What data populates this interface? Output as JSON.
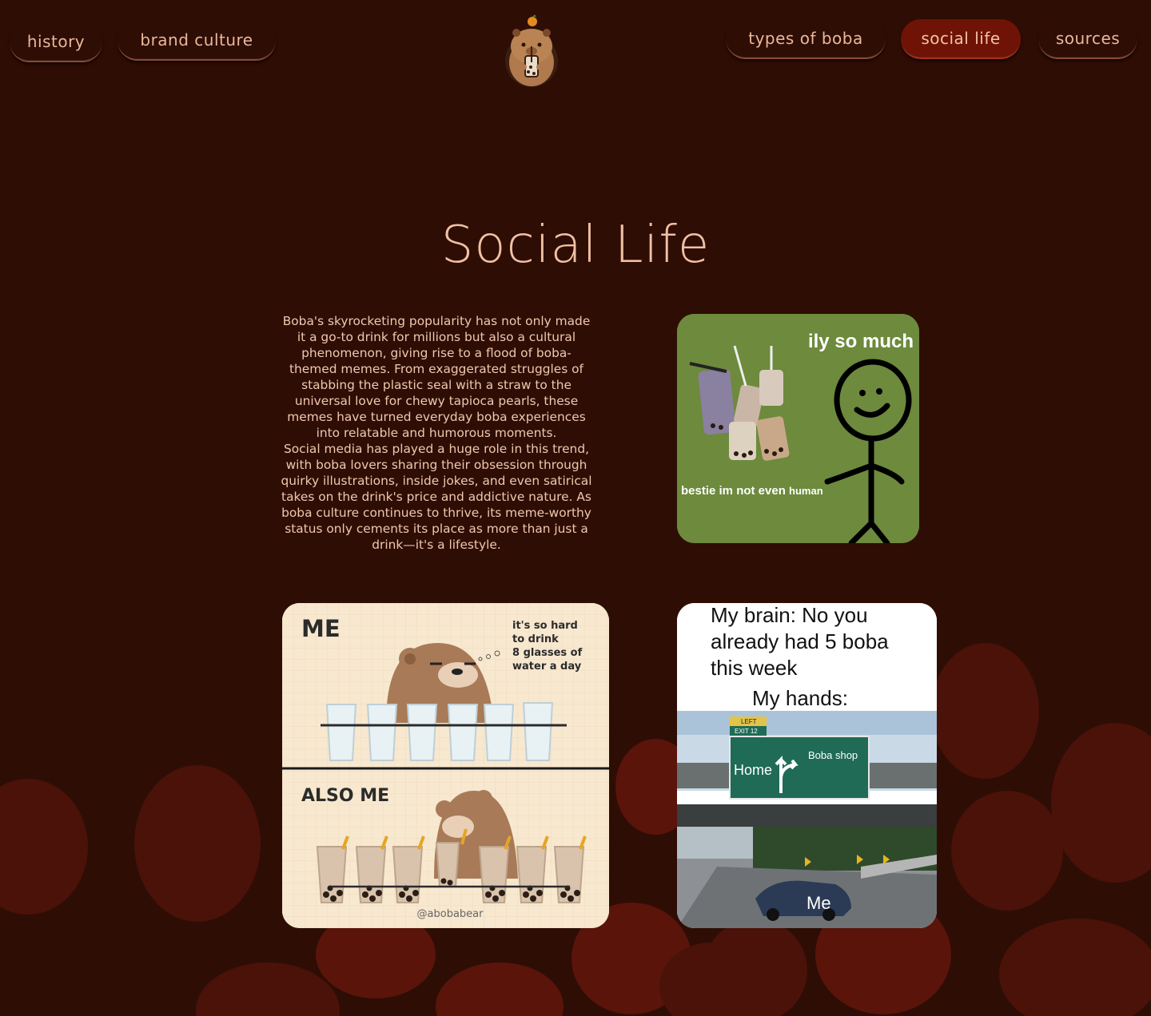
{
  "nav": {
    "history": "history",
    "brand_culture": "brand culture",
    "types_of_boba": "types of boba",
    "social_life": "social life",
    "sources": "sources"
  },
  "page": {
    "title": "Social Life"
  },
  "content": {
    "paragraph_1": "Boba's skyrocketing popularity has not only made it a go-to drink for millions but also a cultural phenomenon, giving rise to a flood of boba-themed memes. From exaggerated struggles of stabbing the plastic seal with a straw to the universal love for chewy tapioca pearls, these memes have turned everyday boba experiences into relatable and humorous moments.",
    "paragraph_2": "Social media has played a huge role in this trend, with boba lovers sharing their obsession through quirky illustrations, inside jokes, and even satirical takes on the drink's price and addictive nature. As boba culture continues to thrive, its meme-worthy status only cements its place as more than just a drink—it's a lifestyle."
  },
  "memes": {
    "stickman": {
      "top_text": "ily so much",
      "bottom_text_a": "bestie im not even ",
      "bottom_text_b": "human"
    },
    "bear": {
      "top": "ME",
      "thought": [
        "it's so hard",
        "to drink",
        "8 glasses of",
        "water a day"
      ],
      "bottom": "ALSO ME",
      "credit": "@abobabear"
    },
    "brain": {
      "line1": "My brain: No you",
      "line2": "already had 5 boba",
      "line3": "this week",
      "line4": "My hands:",
      "sign_left": "Home",
      "sign_right": "Boba shop",
      "sign_tag": "LEFT",
      "sign_exit": "EXIT 12",
      "car_label": "Me"
    }
  },
  "colors": {
    "background": "#2e0d05",
    "accent_active": "#6e1305",
    "text": "#f0c3a8"
  }
}
